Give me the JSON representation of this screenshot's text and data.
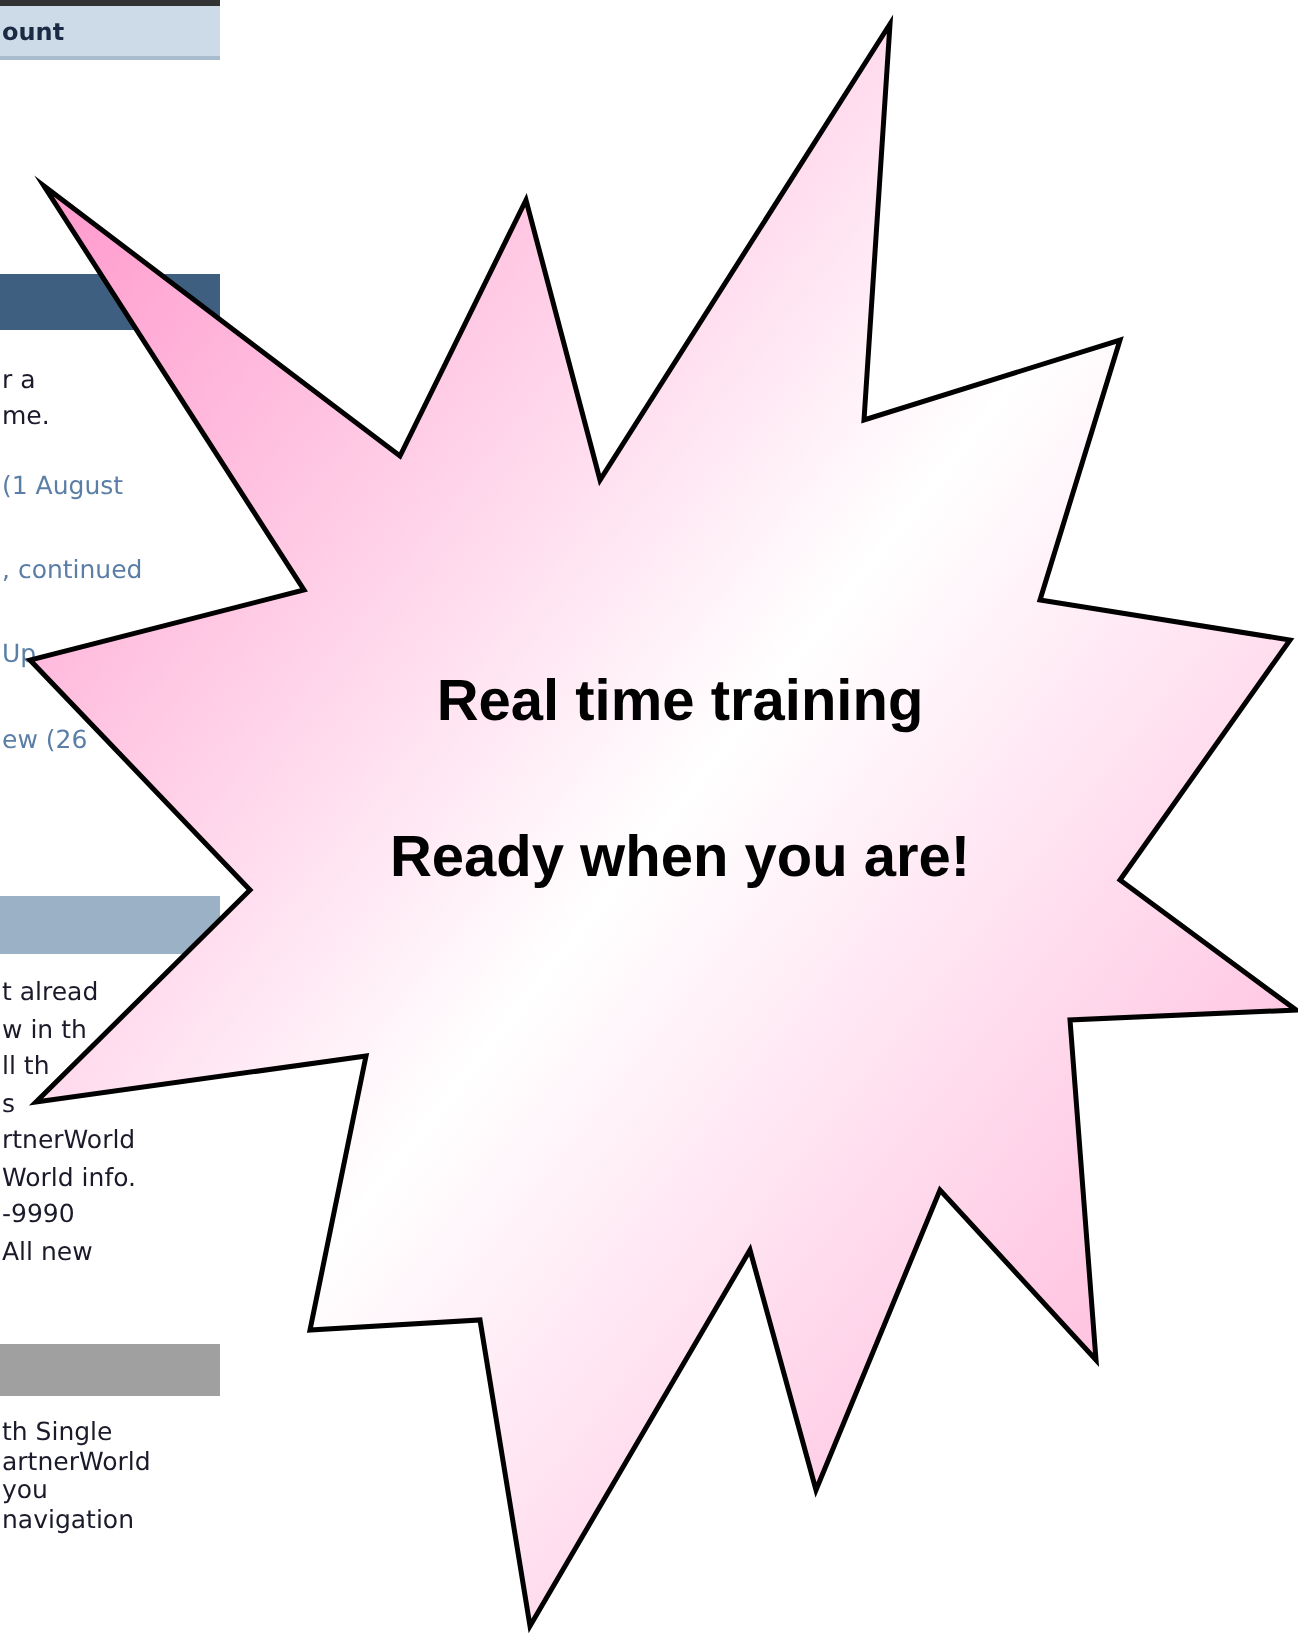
{
  "page": {
    "top_bar": {
      "label": "ount"
    },
    "sections": [
      {
        "kind": "dark",
        "lines": [
          {
            "kind": "text",
            "text": "r a"
          },
          {
            "kind": "text",
            "text": "me."
          },
          {
            "kind": "link",
            "text": "(1 August"
          },
          {
            "kind": "link",
            "text": ", continued"
          },
          {
            "kind": "link",
            "text": "Up"
          },
          {
            "kind": "link",
            "text": "ew (26"
          }
        ]
      },
      {
        "kind": "light",
        "lines": [
          {
            "kind": "text",
            "text": "t alread"
          },
          {
            "kind": "text",
            "text": "w in th"
          },
          {
            "kind": "text",
            "text": "ll th"
          },
          {
            "kind": "text",
            "text": "s"
          },
          {
            "kind": "text",
            "text": "rtnerWorld"
          },
          {
            "kind": "text",
            "text": "World info."
          },
          {
            "kind": "text",
            "text": "-9990"
          },
          {
            "kind": "text",
            "text": "All new"
          }
        ]
      },
      {
        "kind": "grey",
        "lines": [
          {
            "kind": "text",
            "text": "th Single"
          },
          {
            "kind": "text",
            "text": "artnerWorld"
          },
          {
            "kind": "text",
            "text": "you"
          },
          {
            "kind": "text",
            "text": "navigation"
          }
        ]
      }
    ]
  },
  "callout": {
    "lines": [
      "Real time training",
      "Ready when you are!"
    ]
  }
}
